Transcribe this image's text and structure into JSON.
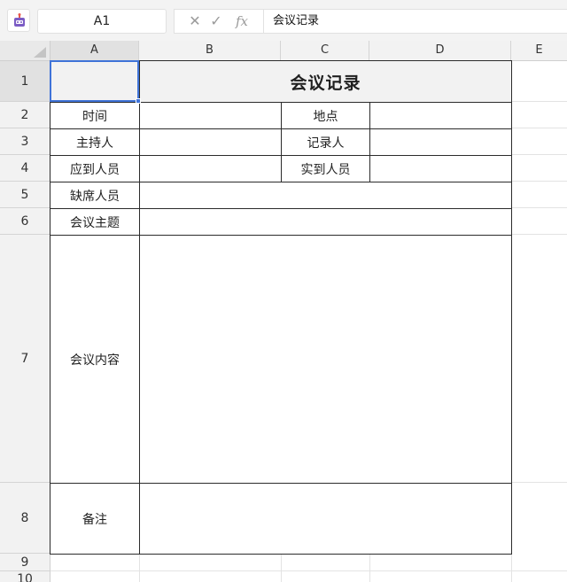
{
  "toolbar": {
    "app_icon": "robot-icon",
    "name_box": "A1",
    "cancel_glyph": "✕",
    "confirm_glyph": "✓",
    "fx_label": "fx",
    "formula_value": "会议记录"
  },
  "sheet": {
    "selected_cell": "A1",
    "columns": [
      "A",
      "B",
      "C",
      "D",
      "E"
    ],
    "rows": [
      "1",
      "2",
      "3",
      "4",
      "5",
      "6",
      "7",
      "8",
      "9",
      "10"
    ],
    "cells": {
      "title": "会议记录",
      "a2": "时间",
      "c2": "地点",
      "a3": "主持人",
      "c3": "记录人",
      "a4": "应到人员",
      "c4": "实到人员",
      "a5": "缺席人员",
      "a6": "会议主题",
      "a7": "会议内容",
      "a8": "备注"
    }
  },
  "colors": {
    "accent": "#3f73d8",
    "header_bg": "#f2f2f2",
    "header_selected_bg": "#e1e1e1",
    "border": "#2b2b2b"
  }
}
